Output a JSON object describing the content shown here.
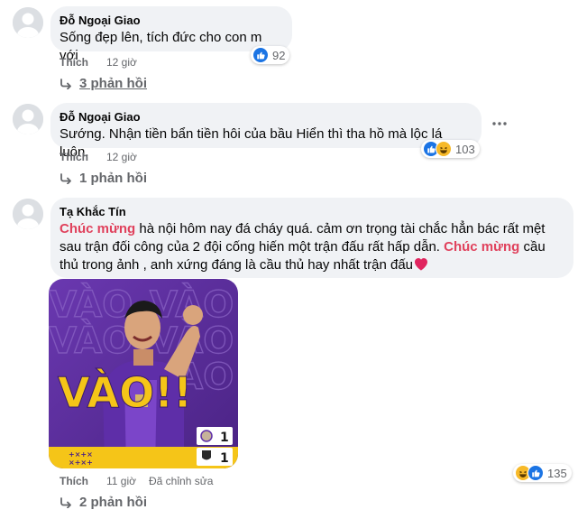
{
  "comments": [
    {
      "author": "Đỗ Ngoại Giao",
      "text": "Sống đẹp lên, tích đức cho con m với",
      "like_label": "Thích",
      "time": "12 giờ",
      "reaction_count": "92",
      "replies_label": "3 phản hồi"
    },
    {
      "author": "Đỗ Ngoại Giao",
      "text": "Sướng. Nhận tiền bẩn tiền hôi của bầu Hiển thì tha hồ mà lộc lá luôn.",
      "like_label": "Thích",
      "time": "12 giờ",
      "reaction_count": "103",
      "replies_label": "1 phản hồi"
    },
    {
      "author": "Tạ Khắc Tín",
      "highlight": "Chúc mừng",
      "text_part1": " hà nội hôm nay đá cháy quá. cảm ơn trọng tài chắc hẳn bác rất mệt sau trận đối công của 2 đội cống hiến một trận đấu rất hấp dẫn. ",
      "text_part2": " cầu thủ trong ảnh , anh xứng đáng là cầu thủ hay nhất trận đấu",
      "like_label": "Thích",
      "time": "11 giờ",
      "edited_label": "Đã chỉnh sửa",
      "reaction_count": "135",
      "replies_label": "2 phản hồi",
      "image": {
        "headline": "VÀO!!",
        "bg_word": "VÀO",
        "score_home": "1",
        "score_away": "1"
      }
    }
  ],
  "icons": {
    "like": "like-icon",
    "haha": "haha-icon",
    "heart": "heart-emoji",
    "reply_arrow": "reply-arrow-icon",
    "more": "more-options-icon"
  },
  "colors": {
    "bubble_bg": "#f0f2f5",
    "like_blue": "#1b74e4",
    "haha_yellow": "#f7b928",
    "highlight_red": "#e0415c",
    "meta_gray": "#65676b",
    "photo_purple": "#5b2f9c",
    "photo_yellow": "#f5c518"
  }
}
